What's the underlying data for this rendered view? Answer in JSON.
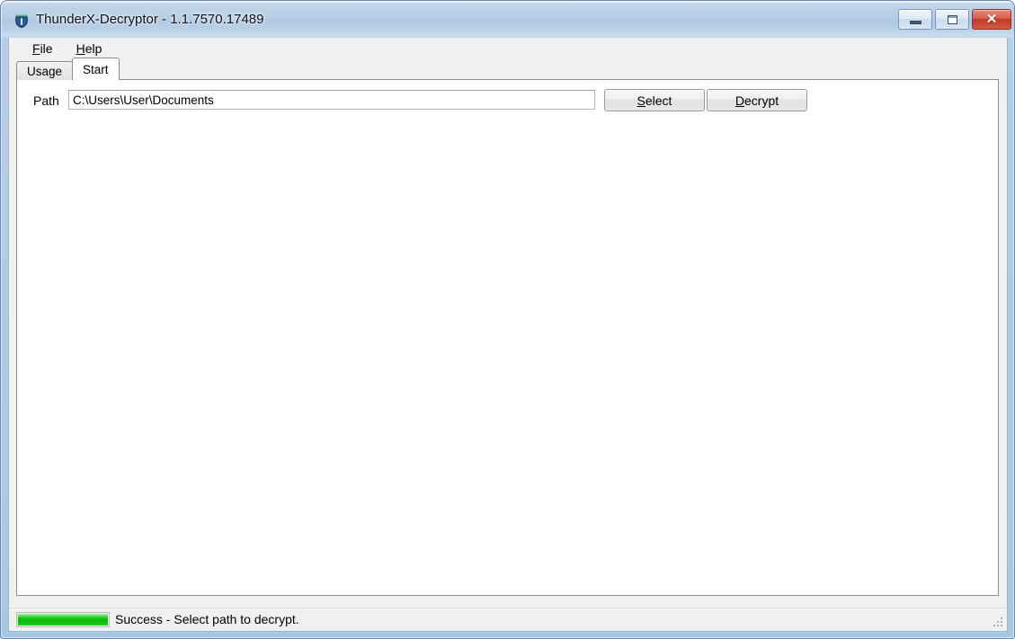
{
  "window": {
    "title": "ThunderX-Decryptor - 1.1.7570.17489",
    "icon": "shield-icon",
    "controls": {
      "minimize_label": "–",
      "maximize_label": "□",
      "close_label": "✕"
    }
  },
  "menu": {
    "items": [
      {
        "label": "File",
        "mnemonic": "F",
        "rest": "ile"
      },
      {
        "label": "Help",
        "mnemonic": "H",
        "rest": "elp"
      }
    ]
  },
  "tabs": [
    {
      "label": "Usage",
      "active": false
    },
    {
      "label": "Start",
      "active": true
    }
  ],
  "start_tab": {
    "path_label": "Path",
    "path_value": "C:\\Users\\User\\Documents",
    "path_placeholder": "",
    "buttons": [
      {
        "name": "select-button",
        "mnemonic": "S",
        "rest": "elect",
        "label": "Select"
      },
      {
        "name": "decrypt-button",
        "mnemonic": "D",
        "rest": "ecrypt",
        "label": "Decrypt"
      }
    ]
  },
  "status_bar": {
    "message": "Success - Select path to decrypt.",
    "progress_percent": 100,
    "progress_color": "#0cb90c",
    "grip": "resize-grip-icon"
  },
  "colors": {
    "frame": "#aac7e2",
    "title_text": "#10131a",
    "close_button": "#bf3a22",
    "client_bg": "#f0f0f0",
    "page_bg": "#ffffff",
    "progress_green": "#0cb90c"
  }
}
